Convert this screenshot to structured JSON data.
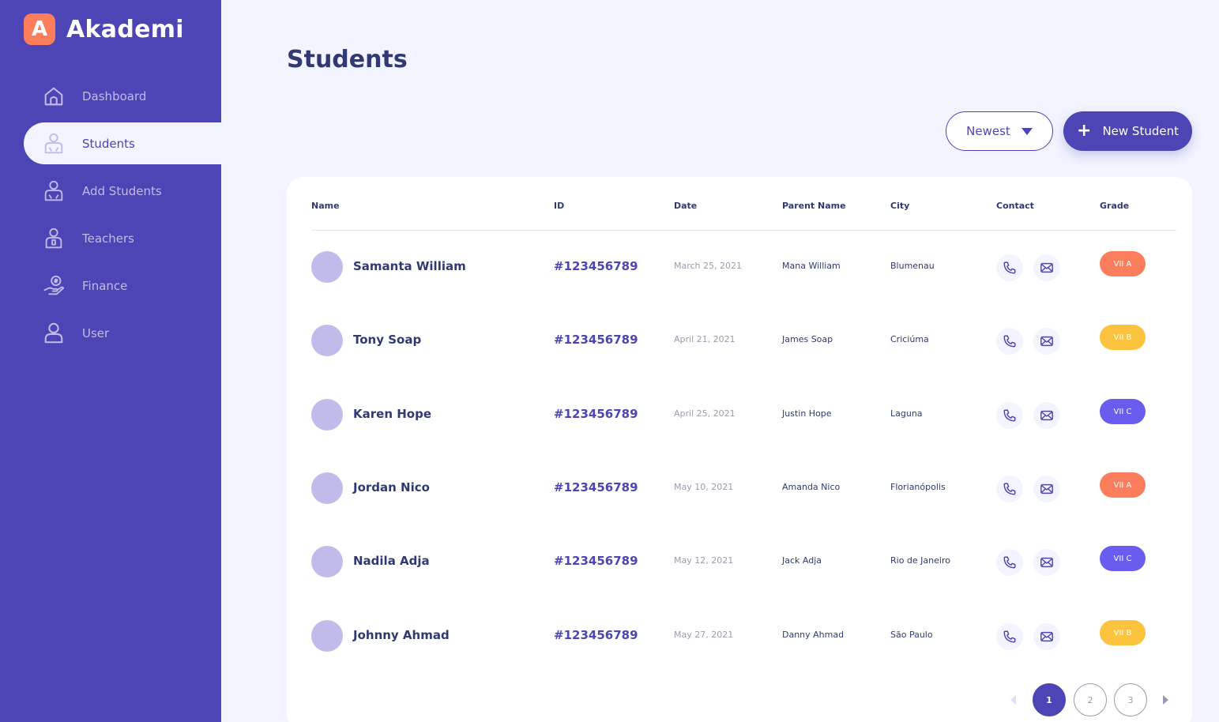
{
  "brand": {
    "logo_letter": "A",
    "name": "Akademi"
  },
  "sidebar": {
    "items": [
      {
        "label": "Dashboard",
        "icon": "home-icon",
        "active": false
      },
      {
        "label": "Students",
        "icon": "student-icon",
        "active": true
      },
      {
        "label": "Add Students",
        "icon": "add-student-icon",
        "active": false
      },
      {
        "label": "Teachers",
        "icon": "teacher-icon",
        "active": false
      },
      {
        "label": "Finance",
        "icon": "finance-icon",
        "active": false
      },
      {
        "label": "User",
        "icon": "user-icon",
        "active": false
      }
    ]
  },
  "main": {
    "title": "Students",
    "sort_label": "Newest",
    "new_button_label": "New Student"
  },
  "table": {
    "columns": [
      "Name",
      "ID",
      "Date",
      "Parent Name",
      "City",
      "Contact",
      "Grade"
    ],
    "rows": [
      {
        "name": "Samanta William",
        "id": "#123456789",
        "date": "March 25, 2021",
        "parent": "Mana William",
        "city": "Blumenau",
        "grade": "VII A",
        "grade_color": "#FB7D5B"
      },
      {
        "name": "Tony Soap",
        "id": "#123456789",
        "date": "April 21, 2021",
        "parent": "James Soap",
        "city": "Criciúma",
        "grade": "VII B",
        "grade_color": "#FCC43E"
      },
      {
        "name": "Karen Hope",
        "id": "#123456789",
        "date": "April 25, 2021",
        "parent": "Justin Hope",
        "city": "Laguna",
        "grade": "VII C",
        "grade_color": "#6B5CF0"
      },
      {
        "name": "Jordan Nico",
        "id": "#123456789",
        "date": "May 10, 2021",
        "parent": "Amanda Nico",
        "city": "Florianópolis",
        "grade": "VII A",
        "grade_color": "#FB7D5B"
      },
      {
        "name": "Nadila Adja",
        "id": "#123456789",
        "date": "May 12, 2021",
        "parent": "Jack Adja",
        "city": "Rio de Janeiro",
        "grade": "VII C",
        "grade_color": "#6B5CF0"
      },
      {
        "name": "Johnny Ahmad",
        "id": "#123456789",
        "date": "May 27, 2021",
        "parent": "Danny Ahmad",
        "city": "São Paulo",
        "grade": "VII B",
        "grade_color": "#FCC43E"
      }
    ]
  },
  "pagination": {
    "pages": [
      "1",
      "2",
      "3"
    ],
    "current": "1"
  },
  "colors": {
    "primary": "#4D44B5",
    "text_dark": "#303972",
    "muted": "#A098AE",
    "avatar": "#C1BBEB",
    "background": "#F3F4FF"
  }
}
